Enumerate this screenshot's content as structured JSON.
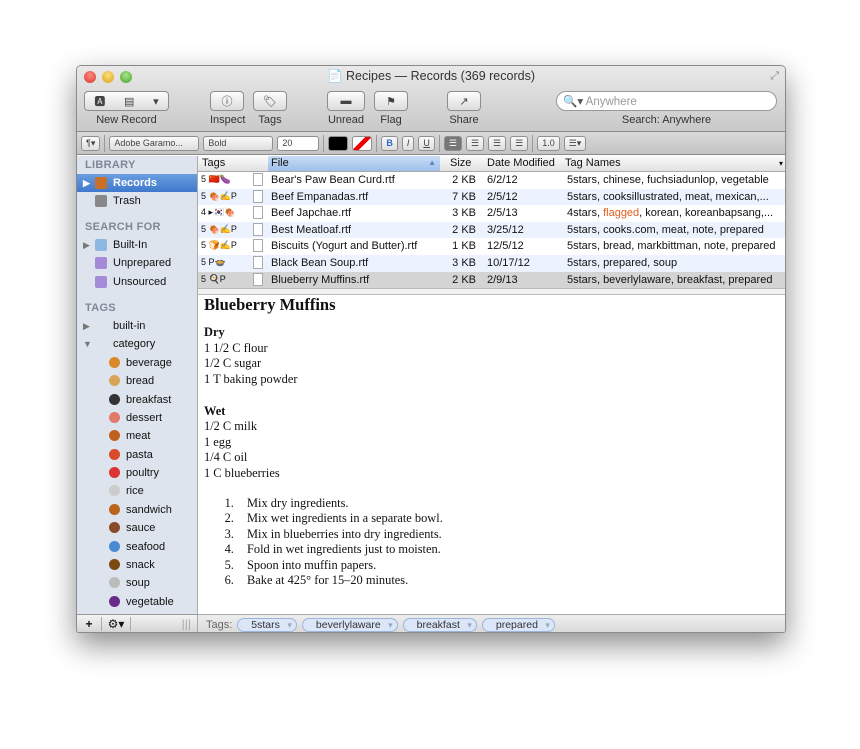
{
  "window": {
    "title": "Recipes — Records (369 records)"
  },
  "toolbar": {
    "new_record": "New Record",
    "inspect": "Inspect",
    "tags": "Tags",
    "unread": "Unread",
    "flag": "Flag",
    "share": "Share",
    "search_placeholder": "Anywhere",
    "search_label": "Search: Anywhere"
  },
  "format": {
    "paragraph": "¶▾",
    "font": "Adobe Garamo...",
    "style": "Bold",
    "size": "20",
    "bold": "B",
    "italic": "I",
    "underline": "U",
    "spacing": "1.0",
    "list": "☰▾"
  },
  "sidebar": {
    "library_header": "LIBRARY",
    "library": [
      {
        "label": "Records",
        "selected": true,
        "icon": "cabinet-icon"
      },
      {
        "label": "Trash",
        "icon": "trash-icon"
      }
    ],
    "search_header": "SEARCH FOR",
    "searches": [
      {
        "label": "Built-In",
        "icon": "folder-icon"
      },
      {
        "label": "Unprepared",
        "icon": "smart-folder-icon"
      },
      {
        "label": "Unsourced",
        "icon": "smart-folder-icon"
      }
    ],
    "tags_header": "TAGS",
    "tag_groups": [
      {
        "label": "built-in"
      },
      {
        "label": "category"
      }
    ],
    "category_tags": [
      {
        "label": "beverage",
        "color": "#d9892a"
      },
      {
        "label": "bread",
        "color": "#d8a556"
      },
      {
        "label": "breakfast",
        "color": "#333"
      },
      {
        "label": "dessert",
        "color": "#e07a6a"
      },
      {
        "label": "meat",
        "color": "#c0601e"
      },
      {
        "label": "pasta",
        "color": "#d94a2a"
      },
      {
        "label": "poultry",
        "color": "#d33"
      },
      {
        "label": "rice",
        "color": "#ccc"
      },
      {
        "label": "sandwich",
        "color": "#b8641c"
      },
      {
        "label": "sauce",
        "color": "#8a4a2a"
      },
      {
        "label": "seafood",
        "color": "#4a8ad0"
      },
      {
        "label": "snack",
        "color": "#7a4a10"
      },
      {
        "label": "soup",
        "color": "#bbb"
      },
      {
        "label": "vegetable",
        "color": "#6a2a8a"
      }
    ]
  },
  "table": {
    "columns": [
      "Tags",
      "File",
      "Size",
      "Date Modified",
      "Tag Names"
    ],
    "rows": [
      {
        "tags": "5 🇨🇳🍆",
        "file": "Bear's Paw Bean Curd.rtf",
        "size": "2 KB",
        "date": "6/2/12",
        "tag_names": "5stars, chinese, fuchsiadunlop, vegetable"
      },
      {
        "tags": "5 🍖✍P",
        "file": "Beef Empanadas.rtf",
        "size": "7 KB",
        "date": "2/5/12",
        "tag_names": "5stars, cooksillustrated, meat, mexican,..."
      },
      {
        "tags": "4 ▸🇰🇷🍖",
        "file": "Beef Japchae.rtf",
        "size": "3 KB",
        "date": "2/5/13",
        "tag_names_pre": "4stars, ",
        "flagged": "flagged",
        "tag_names": ", korean, koreanbapsang,..."
      },
      {
        "tags": "5 🍖✍P",
        "file": "Best Meatloaf.rtf",
        "size": "2 KB",
        "date": "3/25/12",
        "tag_names": "5stars, cooks.com, meat, note, prepared"
      },
      {
        "tags": "5 🍞✍P",
        "file": "Biscuits (Yogurt and Butter).rtf",
        "size": "1 KB",
        "date": "12/5/12",
        "tag_names": "5stars, bread, markbittman, note, prepared"
      },
      {
        "tags": "5 P🍲",
        "file": "Black Bean Soup.rtf",
        "size": "3 KB",
        "date": "10/17/12",
        "tag_names": "5stars, prepared, soup"
      },
      {
        "tags": "5 🍳P",
        "file": "Blueberry Muffins.rtf",
        "size": "2 KB",
        "date": "2/9/13",
        "tag_names": "5stars, beverlylaware, breakfast, prepared",
        "selected": true
      }
    ]
  },
  "document": {
    "title": "Blueberry Muffins",
    "dry_header": "Dry",
    "dry": [
      "1 1/2 C flour",
      "1/2 C sugar",
      "1 T baking powder"
    ],
    "wet_header": "Wet",
    "wet": [
      "1/2 C milk",
      "1 egg",
      "1/4 C oil",
      "1 C blueberries"
    ],
    "steps": [
      "Mix dry ingredients.",
      "Mix wet ingredients in a separate bowl.",
      "Mix in blueberries into dry ingredients.",
      "Fold in wet ingredients just to moisten.",
      "Spoon into muffin papers.",
      "Bake at 425° for 15–20 minutes."
    ]
  },
  "tagbar": {
    "label": "Tags:",
    "tags": [
      "5stars",
      "beverlylaware",
      "breakfast",
      "prepared"
    ]
  },
  "colors": {
    "selection": "#3f78cc",
    "flagged": "#e0601e",
    "sidebar": "#dde4ed"
  }
}
